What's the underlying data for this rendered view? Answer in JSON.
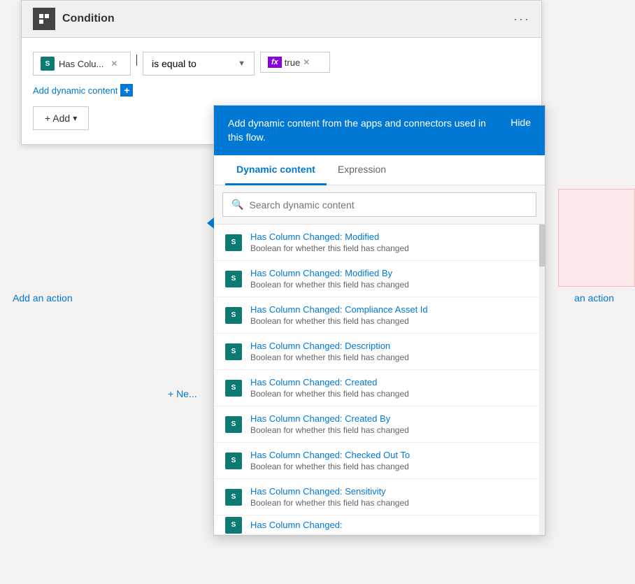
{
  "page": {
    "title": "Condition",
    "bg_color": "#f3f2f1"
  },
  "condition_card": {
    "title": "Condition",
    "dots_label": "···",
    "chip_text": "Has Colu...",
    "operator_text": "is equal to",
    "fx_value": "true",
    "add_dynamic_label": "Add dynamic content",
    "add_button_label": "+ Add"
  },
  "add_action_left": "Add an action",
  "add_action_right": "an action",
  "new_button": "+ Ne...",
  "dynamic_popup": {
    "header_text": "Add dynamic content from the apps and connectors used in this flow.",
    "hide_label": "Hide",
    "tabs": [
      {
        "label": "Dynamic content",
        "active": true
      },
      {
        "label": "Expression",
        "active": false
      }
    ],
    "search_placeholder": "Search dynamic content",
    "items": [
      {
        "title": "Has Column Changed: Modified",
        "subtitle": "Boolean for whether this field has changed"
      },
      {
        "title": "Has Column Changed: Modified By",
        "subtitle": "Boolean for whether this field has changed"
      },
      {
        "title": "Has Column Changed: Compliance Asset Id",
        "subtitle": "Boolean for whether this field has changed"
      },
      {
        "title": "Has Column Changed: Description",
        "subtitle": "Boolean for whether this field has changed"
      },
      {
        "title": "Has Column Changed: Created",
        "subtitle": "Boolean for whether this field has changed"
      },
      {
        "title": "Has Column Changed: Created By",
        "subtitle": "Boolean for whether this field has changed"
      },
      {
        "title": "Has Column Changed: Checked Out To",
        "subtitle": "Boolean for whether this field has changed"
      },
      {
        "title": "Has Column Changed: Sensitivity",
        "subtitle": "Boolean for whether this field has changed"
      },
      {
        "title": "Has Column Changed:",
        "subtitle": ""
      }
    ]
  }
}
